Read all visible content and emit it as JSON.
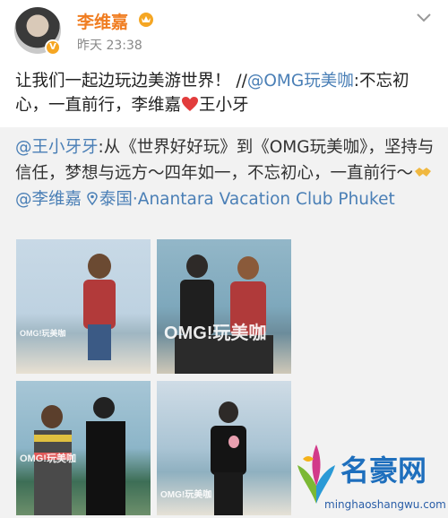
{
  "post": {
    "username": "李维嘉",
    "timestamp": "昨天 23:38",
    "text_main": "让我们一起边玩边美游世界！ //",
    "text_mention": "@OMG玩美咖",
    "text_rest": ":不忘初心，一直前行，李维嘉",
    "text_tail": "王小牙"
  },
  "repost": {
    "mention": "@王小牙牙",
    "text1": ":从《世界好好玩》到《OMG玩美咖》，坚持与信任，梦想与远方～四年如一，不忘初心，一直前行～",
    "mention2": "@李维嘉",
    "location": "泰国·Anantara Vacation Club Phuket",
    "photos": [
      {
        "label": "OMG!玩美咖"
      },
      {
        "label": "OMG!玩美咖"
      },
      {
        "label": "OMG!玩美咖"
      },
      {
        "label": "OMG!玩美咖"
      }
    ]
  },
  "watermark": {
    "title": "名豪网",
    "url": "minghaoshangwu.com"
  },
  "colors": {
    "accent": "#f07d21",
    "link": "#4a7fb6",
    "repost_bg": "#f2f2f2"
  },
  "icons": [
    "crown-icon",
    "verified-icon",
    "chevron-down-icon",
    "heart-icon",
    "handshake-icon",
    "location-icon"
  ]
}
